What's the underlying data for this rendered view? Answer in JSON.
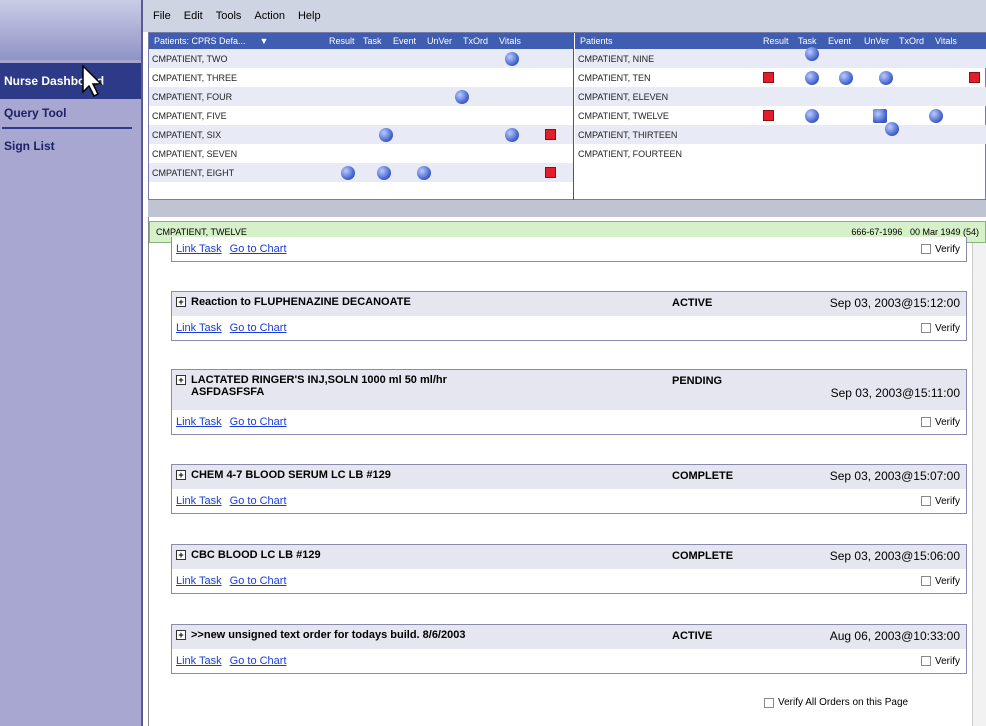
{
  "menu": {
    "items": [
      "File",
      "Edit",
      "Tools",
      "Action",
      "Help"
    ]
  },
  "sidebar": {
    "items": [
      {
        "label": "Nurse Dashboard"
      },
      {
        "label": "Query Tool"
      },
      {
        "label": "Sign List"
      }
    ]
  },
  "grid_left": {
    "header": "Patients: CPRS Defa...",
    "cols": [
      "Result",
      "Task",
      "Event",
      "UnVer",
      "TxOrd",
      "Vitals"
    ],
    "rows": [
      "CMPATIENT, TWO",
      "CMPATIENT, THREE",
      "CMPATIENT, FOUR",
      "CMPATIENT, FIVE",
      "CMPATIENT, SIX",
      "CMPATIENT, SEVEN",
      "CMPATIENT, EIGHT"
    ]
  },
  "grid_right": {
    "header": "Patients",
    "cols": [
      "Result",
      "Task",
      "Event",
      "UnVer",
      "TxOrd",
      "Vitals"
    ],
    "rows": [
      "CMPATIENT, NINE",
      "CMPATIENT, TEN",
      "CMPATIENT, ELEVEN",
      "CMPATIENT, TWELVE",
      "CMPATIENT, THIRTEEN",
      "CMPATIENT, FOURTEEN"
    ]
  },
  "patient_bar": {
    "name": "CMPATIENT, TWELVE",
    "ssn": "666-67-1996",
    "dob": "00 Mar 1949 (54)"
  },
  "links": {
    "link_task": "Link Task",
    "go_to_chart": "Go to Chart",
    "verify": "Verify"
  },
  "orders": [
    {
      "title": "Reaction to FLUPHENAZINE DECANOATE",
      "status": "ACTIVE",
      "date": "Sep 03, 2003@15:12:00"
    },
    {
      "title": "LACTATED RINGER'S INJ,SOLN 1000 ml 50 ml/hr ASFDASFSFA",
      "status": "PENDING",
      "date": "Sep 03, 2003@15:11:00"
    },
    {
      "title": "CHEM 4-7 BLOOD SERUM LC LB #129",
      "status": "COMPLETE",
      "date": "Sep 03, 2003@15:07:00"
    },
    {
      "title": "CBC BLOOD LC LB #129",
      "status": "COMPLETE",
      "date": "Sep 03, 2003@15:06:00"
    },
    {
      "title": ">>new unsigned text order for todays build. 8/6/2003",
      "status": "ACTIVE",
      "date": "Aug 06, 2003@10:33:00"
    }
  ],
  "verify_all": "Verify All Orders on this Page"
}
